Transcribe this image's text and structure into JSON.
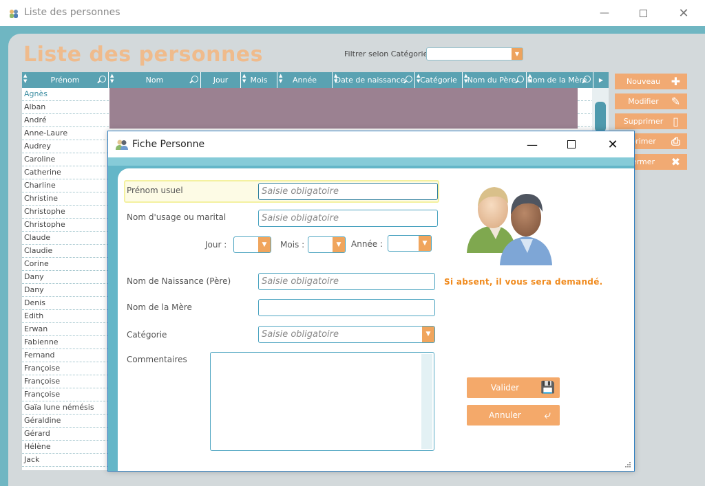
{
  "main_window": {
    "title": "Liste des personnes",
    "heading": "Liste des personnes",
    "filter_label": "Filtrer selon Catégorie",
    "filter_value": "",
    "columns": [
      "Prénom",
      "Nom",
      "Jour",
      "Mois",
      "Année",
      "Date de naissance",
      "Catégorie",
      "Nom du Père",
      "Nom de la Mère"
    ],
    "rows": [
      "Agnès",
      "Alban",
      "André",
      "Anne-Laure",
      "Audrey",
      "Caroline",
      "Catherine",
      "Charline",
      "Christine",
      "Christophe",
      "Christophe",
      "Claude",
      "Claudie",
      "Corine",
      "Dany",
      "Dany",
      "Denis",
      "Edith",
      "Erwan",
      "Fabienne",
      "Fernand",
      "Françoise",
      "Françoise",
      "Françoise",
      "Gaïa lune némésis",
      "Géraldine",
      "Gérard",
      "Hélène",
      "Jack"
    ],
    "side_buttons": [
      {
        "label": "Nouveau",
        "icon": "plus-icon"
      },
      {
        "label": "Modifier",
        "icon": "edit-icon"
      },
      {
        "label": "Supprimer",
        "icon": "trash-icon"
      },
      {
        "label": "primer",
        "icon": "printer-icon"
      },
      {
        "label": "ermer",
        "icon": "close-x-icon"
      }
    ]
  },
  "dialog": {
    "title": "Fiche Personne",
    "fields": {
      "prenom_label": "Prénom usuel",
      "prenom_placeholder": "Saisie obligatoire",
      "nom_usage_label": "Nom d'usage ou marital",
      "nom_usage_placeholder": "Saisie obligatoire",
      "jour_label": "Jour :",
      "mois_label": "Mois :",
      "annee_label": "Année :",
      "nom_naissance_label": "Nom de Naissance (Père)",
      "nom_naissance_placeholder": "Saisie obligatoire",
      "nom_mere_label": "Nom de la Mère",
      "categorie_label": "Catégorie",
      "categorie_placeholder": "Saisie obligatoire",
      "commentaires_label": "Commentaires"
    },
    "absent_note": "Si absent, il vous sera demandé.",
    "valider_label": "Valider",
    "annuler_label": "Annuler"
  },
  "colors": {
    "accent_orange": "#f4a96a",
    "teal": "#5aa2b2",
    "selected_row": "#9b8191",
    "note_orange": "#f08a1d"
  }
}
